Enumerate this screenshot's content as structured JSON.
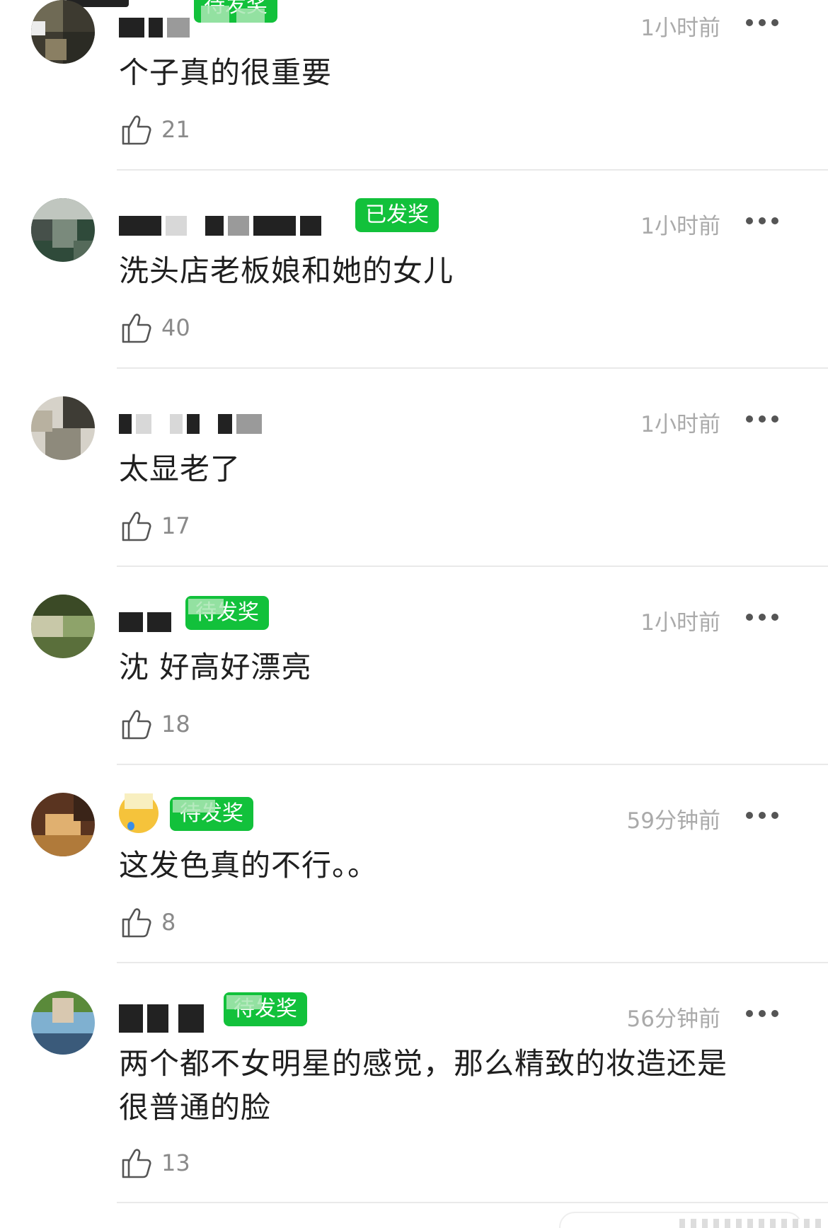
{
  "comments": [
    {
      "badge": "待发奖",
      "time": "1小时前",
      "content": "个子真的很重要",
      "likes": "21",
      "avatar_colors": [
        "#3d3a30",
        "#6f6a55",
        "#2b2b24",
        "#8a7f63"
      ]
    },
    {
      "badge": "已发奖",
      "time": "1小时前",
      "content": "洗头店老板娘和她的女儿",
      "likes": "40",
      "avatar_colors": [
        "#2f4a3a",
        "#7a8a7c",
        "#c0c6bf",
        "#46504a"
      ]
    },
    {
      "badge": "",
      "time": "1小时前",
      "content": "太显老了",
      "likes": "17",
      "avatar_colors": [
        "#d6d2c9",
        "#8e8a7c",
        "#3e3c35",
        "#b8b1a0"
      ]
    },
    {
      "badge": "待发奖",
      "time": "1小时前",
      "content": "沈 好高好漂亮",
      "likes": "18",
      "avatar_colors": [
        "#5a6f3b",
        "#8ea36a",
        "#3b4a26",
        "#c8c8a8"
      ]
    },
    {
      "badge": "待发奖",
      "time": "59分钟前",
      "content": "这发色真的不行。。",
      "likes": "8",
      "avatar_colors": [
        "#5a3420",
        "#b07a3a",
        "#e0b070",
        "#3a2418"
      ]
    },
    {
      "badge": "待发奖",
      "time": "56分钟前",
      "content": "两个都不女明星的感觉，那么精致的妆造还是很普通的脸",
      "likes": "13",
      "avatar_colors": [
        "#7fb0d0",
        "#5a8a3a",
        "#d8c8b0",
        "#3a5a7a"
      ]
    }
  ],
  "colors": {
    "badge_green": "#12c13b",
    "time_gray": "#aaaaaa",
    "text": "#1f1f1f"
  },
  "icons": {
    "like": "thumbs-up-icon",
    "more": "more-horizontal-icon"
  }
}
